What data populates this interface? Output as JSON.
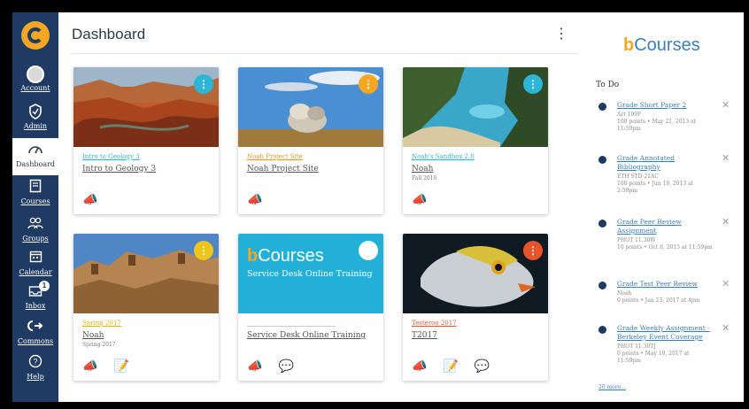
{
  "nav": {
    "items": [
      {
        "label": "Account",
        "icon": "account-icon"
      },
      {
        "label": "Admin",
        "icon": "shield-icon"
      },
      {
        "label": "Dashboard",
        "icon": "dashboard-icon"
      },
      {
        "label": "Courses",
        "icon": "book-icon"
      },
      {
        "label": "Groups",
        "icon": "groups-icon"
      },
      {
        "label": "Calendar",
        "icon": "calendar-icon"
      },
      {
        "label": "Inbox",
        "icon": "inbox-icon",
        "badge": "1"
      },
      {
        "label": "Commons",
        "icon": "commons-icon"
      },
      {
        "label": "Help",
        "icon": "help-icon"
      }
    ]
  },
  "header": {
    "title": "Dashboard",
    "menu_icon": "kebab-menu-icon"
  },
  "cards": [
    {
      "short": "Intro to Geology 3",
      "name": "Intro to Geology 3",
      "term": "",
      "color": "#2bb5d6",
      "image": "canyon",
      "short_color": "#2bb5d6"
    },
    {
      "short": "Noah Project Site",
      "name": "Noah Project Site",
      "term": "",
      "color": "#f5a623",
      "image": "rocks",
      "short_color": "#e8941a"
    },
    {
      "short": "Noah's Sandbox 2.0",
      "name": "Noah",
      "term": "Fall 2016",
      "color": "#2bb5d6",
      "image": "coast",
      "short_color": "#2bb5d6"
    },
    {
      "short": "Spring 2017",
      "name": "Noah",
      "term": "Spring 2017",
      "color": "#f0c419",
      "image": "fortress",
      "short_color": "#e0b400"
    },
    {
      "short": "",
      "name": "Service Desk Online Training",
      "term": "",
      "color": "#ffffff",
      "image": "bcourses-training",
      "banner_brand_b": "b",
      "banner_brand_rest": "Courses",
      "banner_subtitle": "Service Desk Online Training",
      "short_color": "#777"
    },
    {
      "short": "Testeroo 2017",
      "name": "T2017",
      "term": "",
      "color": "#e8542a",
      "image": "fish",
      "short_color": "#e8542a"
    }
  ],
  "brand": {
    "b": "b",
    "rest": "Courses"
  },
  "todo": {
    "heading": "To Do",
    "items": [
      {
        "title": "Grade Short Paper 2",
        "meta": [
          "Art 199F",
          "100 points • May 21, 2013 at 11:59pm"
        ]
      },
      {
        "title": "Grade Annotated Bibliography",
        "meta": [
          "ETH STD 21AC",
          "100 points • Jun 19, 2013 at 2:59pm"
        ]
      },
      {
        "title": "Grade Peer Review Assignment",
        "meta": [
          "PHOT 11.30W",
          "10 points • Oct 6, 2015 at 11:59pm"
        ]
      },
      {
        "title": "Grade Test Peer Review",
        "meta": [
          "Noah",
          "0 points • Jan 23, 2017 at 4pm"
        ]
      },
      {
        "title": "Grade Weekly Assignment - Berkeley Event Coverage",
        "meta": [
          "PHOT 11.30TJ",
          "0 points • May 18, 2017 at 11:59pm"
        ]
      }
    ],
    "more": "20 more..."
  },
  "colors": {
    "nav_bg": "#1f3a63",
    "brand_blue": "#3a7ec2",
    "brand_gold": "#f5a623"
  }
}
